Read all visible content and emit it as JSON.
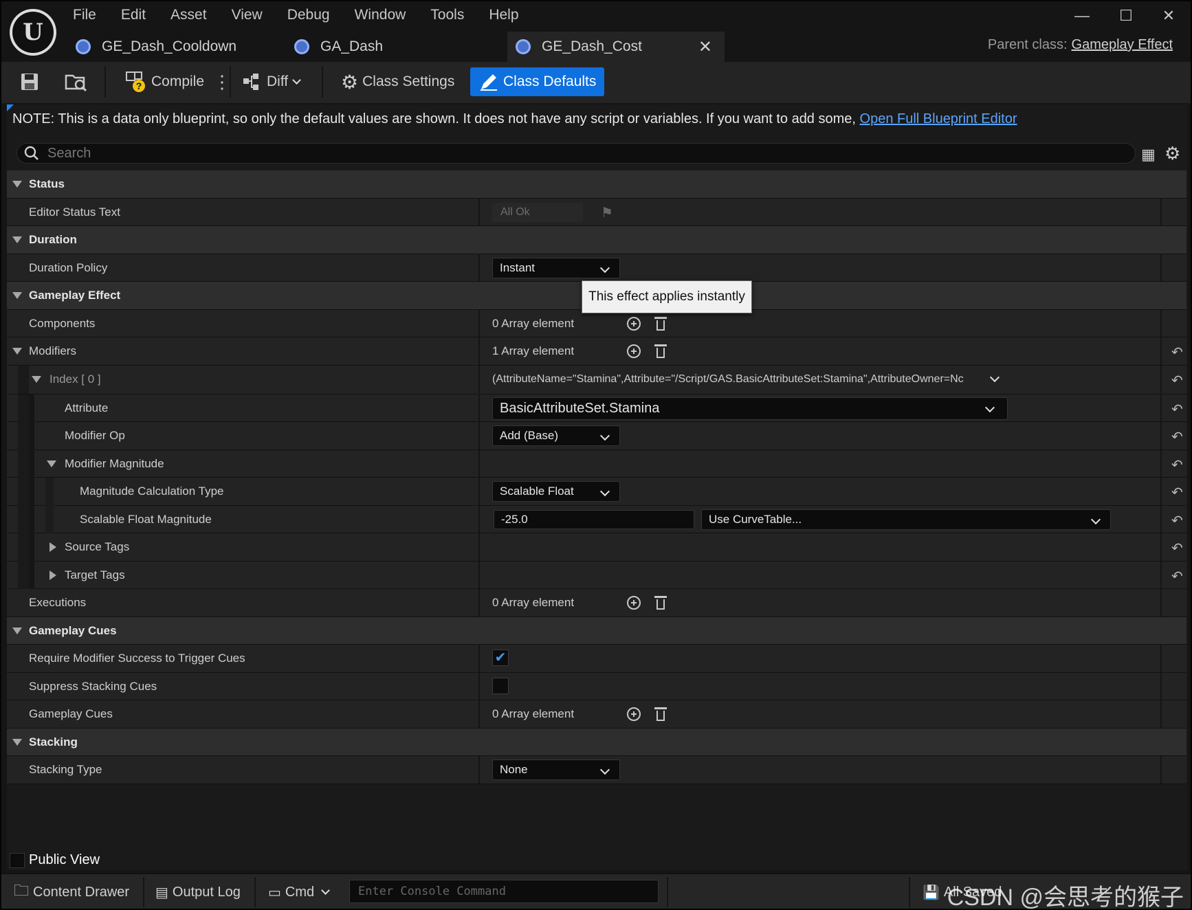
{
  "menu": [
    "File",
    "Edit",
    "Asset",
    "View",
    "Debug",
    "Window",
    "Tools",
    "Help"
  ],
  "tabs": [
    {
      "label": "GE_Dash_Cooldown"
    },
    {
      "label": "GA_Dash"
    },
    {
      "label": "GE_Dash_Cost"
    }
  ],
  "parent_class": {
    "label": "Parent class:",
    "value": "Gameplay Effect"
  },
  "toolbar": {
    "compile": "Compile",
    "diff": "Diff",
    "class_settings": "Class Settings",
    "class_defaults": "Class Defaults"
  },
  "note": {
    "text": "NOTE: This is a data only blueprint, so only the default values are shown.  It does not have any script or variables.  If you want to add some, ",
    "link": "Open Full Blueprint Editor"
  },
  "search": {
    "placeholder": "Search"
  },
  "sections": {
    "status": {
      "title": "Status",
      "editor_status_text": {
        "label": "Editor Status Text",
        "value": "All Ok"
      }
    },
    "duration": {
      "title": "Duration",
      "duration_policy": {
        "label": "Duration Policy",
        "value": "Instant"
      }
    },
    "gameplay_effect": {
      "title": "Gameplay Effect",
      "components": {
        "label": "Components",
        "value": "0 Array element"
      },
      "modifiers": {
        "label": "Modifiers",
        "value": "1 Array element"
      },
      "index0": {
        "label": "Index [ 0 ]",
        "value": "(AttributeName=\"Stamina\",Attribute=\"/Script/GAS.BasicAttributeSet:Stamina\",AttributeOwner=Nc"
      },
      "attribute": {
        "label": "Attribute",
        "value": "BasicAttributeSet.Stamina"
      },
      "modifier_op": {
        "label": "Modifier Op",
        "value": "Add (Base)"
      },
      "modifier_magnitude": {
        "label": "Modifier Magnitude"
      },
      "magnitude_calc_type": {
        "label": "Magnitude Calculation Type",
        "value": "Scalable Float"
      },
      "scalable_float_magnitude": {
        "label": "Scalable Float Magnitude",
        "value": "-25.0",
        "curve": "Use CurveTable..."
      },
      "source_tags": {
        "label": "Source Tags"
      },
      "target_tags": {
        "label": "Target Tags"
      },
      "executions": {
        "label": "Executions",
        "value": "0 Array element"
      }
    },
    "gameplay_cues": {
      "title": "Gameplay Cues",
      "require_modifier_success": {
        "label": "Require Modifier Success to Trigger Cues",
        "checked": true
      },
      "suppress_stacking": {
        "label": "Suppress Stacking Cues",
        "checked": false
      },
      "gameplay_cues": {
        "label": "Gameplay Cues",
        "value": "0 Array element"
      }
    },
    "stacking": {
      "title": "Stacking",
      "stacking_type": {
        "label": "Stacking Type",
        "value": "None"
      }
    }
  },
  "tooltip": "This effect applies instantly",
  "public_view": "Public View",
  "statusbar": {
    "content_drawer": "Content Drawer",
    "output_log": "Output Log",
    "cmd": "Cmd",
    "console_placeholder": "Enter Console Command",
    "all_saved": "All Saved",
    "watermark": "CSDN @会思考的猴子"
  },
  "colors": {
    "accent": "#0f70e0",
    "link": "#5aa5ff",
    "check": "#3c9cff",
    "tab_icon": "#4a70c8"
  }
}
